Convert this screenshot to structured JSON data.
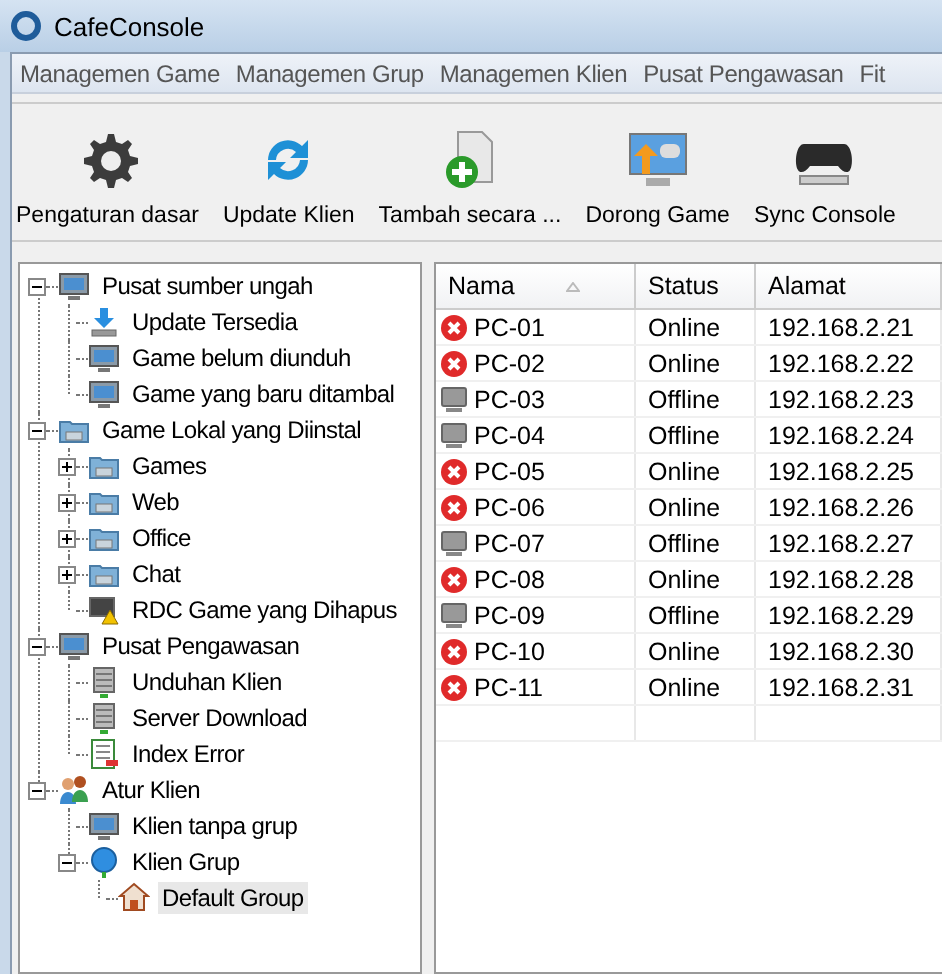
{
  "window": {
    "title": "CafeConsole"
  },
  "menu": [
    "Managemen Game",
    "Managemen Grup",
    "Managemen Klien",
    "Pusat Pengawasan",
    "Fit"
  ],
  "toolbar": [
    {
      "kind": "gear",
      "label": "Pengaturan dasar"
    },
    {
      "kind": "refresh",
      "label": "Update Klien"
    },
    {
      "kind": "add-file",
      "label": "Tambah secara ..."
    },
    {
      "kind": "push",
      "label": "Dorong Game"
    },
    {
      "kind": "gamepad",
      "label": "Sync Console"
    }
  ],
  "tree": [
    {
      "label": "Pusat sumber ungah",
      "kind": "monitor",
      "expanded": true,
      "selected": false,
      "children": [
        {
          "label": "Update Tersedia",
          "kind": "download",
          "selected": false
        },
        {
          "label": "Game belum diunduh",
          "kind": "monitor",
          "selected": false
        },
        {
          "label": "Game yang baru ditambal",
          "kind": "monitor",
          "selected": false
        }
      ]
    },
    {
      "label": "Game Lokal yang Diinstal",
      "kind": "folder",
      "expanded": true,
      "selected": false,
      "children": [
        {
          "label": "Games",
          "kind": "folder",
          "expanded": false,
          "selected": false
        },
        {
          "label": "Web",
          "kind": "folder",
          "expanded": false,
          "selected": false
        },
        {
          "label": "Office",
          "kind": "folder",
          "expanded": false,
          "selected": false
        },
        {
          "label": "Chat",
          "kind": "folder",
          "expanded": false,
          "selected": false
        },
        {
          "label": "RDC Game yang Dihapus",
          "kind": "warning",
          "selected": false
        }
      ]
    },
    {
      "label": "Pusat Pengawasan",
      "kind": "monitor",
      "expanded": true,
      "selected": false,
      "children": [
        {
          "label": "Unduhan Klien",
          "kind": "server",
          "selected": false
        },
        {
          "label": "Server Download",
          "kind": "server",
          "selected": false
        },
        {
          "label": "Index Error",
          "kind": "document",
          "selected": false
        }
      ]
    },
    {
      "label": "Atur Klien",
      "kind": "people",
      "expanded": true,
      "selected": false,
      "children": [
        {
          "label": "Klien tanpa grup",
          "kind": "monitor",
          "selected": false
        },
        {
          "label": "Klien Grup",
          "kind": "globe",
          "expanded": true,
          "selected": false,
          "children": [
            {
              "label": "Default Group",
              "kind": "house",
              "selected": true
            }
          ]
        }
      ]
    }
  ],
  "table": {
    "columns": [
      "Nama",
      "Status",
      "Alamat"
    ],
    "rows": [
      {
        "kind": "error",
        "name": "PC-01",
        "status": "Online",
        "address": "192.168.2.21"
      },
      {
        "kind": "error",
        "name": "PC-02",
        "status": "Online",
        "address": "192.168.2.22"
      },
      {
        "kind": "monitor",
        "name": "PC-03",
        "status": "Offline",
        "address": "192.168.2.23"
      },
      {
        "kind": "monitor",
        "name": "PC-04",
        "status": "Offline",
        "address": "192.168.2.24"
      },
      {
        "kind": "error",
        "name": "PC-05",
        "status": "Online",
        "address": "192.168.2.25"
      },
      {
        "kind": "error",
        "name": "PC-06",
        "status": "Online",
        "address": "192.168.2.26"
      },
      {
        "kind": "monitor",
        "name": "PC-07",
        "status": "Offline",
        "address": "192.168.2.27"
      },
      {
        "kind": "error",
        "name": "PC-08",
        "status": "Online",
        "address": "192.168.2.28"
      },
      {
        "kind": "monitor",
        "name": "PC-09",
        "status": "Offline",
        "address": "192.168.2.29"
      },
      {
        "kind": "error",
        "name": "PC-10",
        "status": "Online",
        "address": "192.168.2.30"
      },
      {
        "kind": "error",
        "name": "PC-11",
        "status": "Online",
        "address": "192.168.2.31"
      }
    ]
  }
}
